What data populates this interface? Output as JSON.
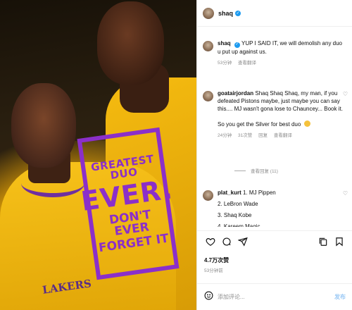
{
  "photo": {
    "stamp_line1": "GREATEST DUO",
    "stamp_line2": "EVER.",
    "stamp_line3": "DON'T EVER",
    "stamp_line4": "FORGET IT",
    "jersey_text": "LAKERS",
    "colors": {
      "stamp": "#8b2fc9",
      "jersey": "#f3b70c"
    }
  },
  "header": {
    "username": "shaq",
    "verified": true
  },
  "caption": {
    "username": "shaq",
    "text": "YUP I SAID IT, we will demolish any duo u put up against us.",
    "time": "53分钟",
    "translate": "查看翻译"
  },
  "comments": [
    {
      "username": "goatairjordan",
      "text": "Shaq Shaq Shaq, my man, if you defeated Pistons maybe, just maybe you can say this.... MJ wasn't gona lose to Chauncey... Book it.",
      "text2": "So you get the Silver for best duo",
      "time": "24分钟",
      "likes": "31次赞",
      "reply": "回复",
      "translate": "查看翻译",
      "view_replies": "查看回复 (11)"
    },
    {
      "username": "plat_kurt",
      "line1": "1. MJ Pippen",
      "line2": "2. LeBron Wade",
      "line3": "3. Shaq Kobe",
      "line4": "4. Kareem Magic"
    }
  ],
  "footer": {
    "likes": "4.7万次赞",
    "time": "53分钟前",
    "comment_placeholder": "添加评论...",
    "post": "发布"
  },
  "icons": [
    "heart-icon",
    "comment-icon",
    "share-icon",
    "copy-icon",
    "save-icon",
    "emoji-icon",
    "verified-icon"
  ]
}
